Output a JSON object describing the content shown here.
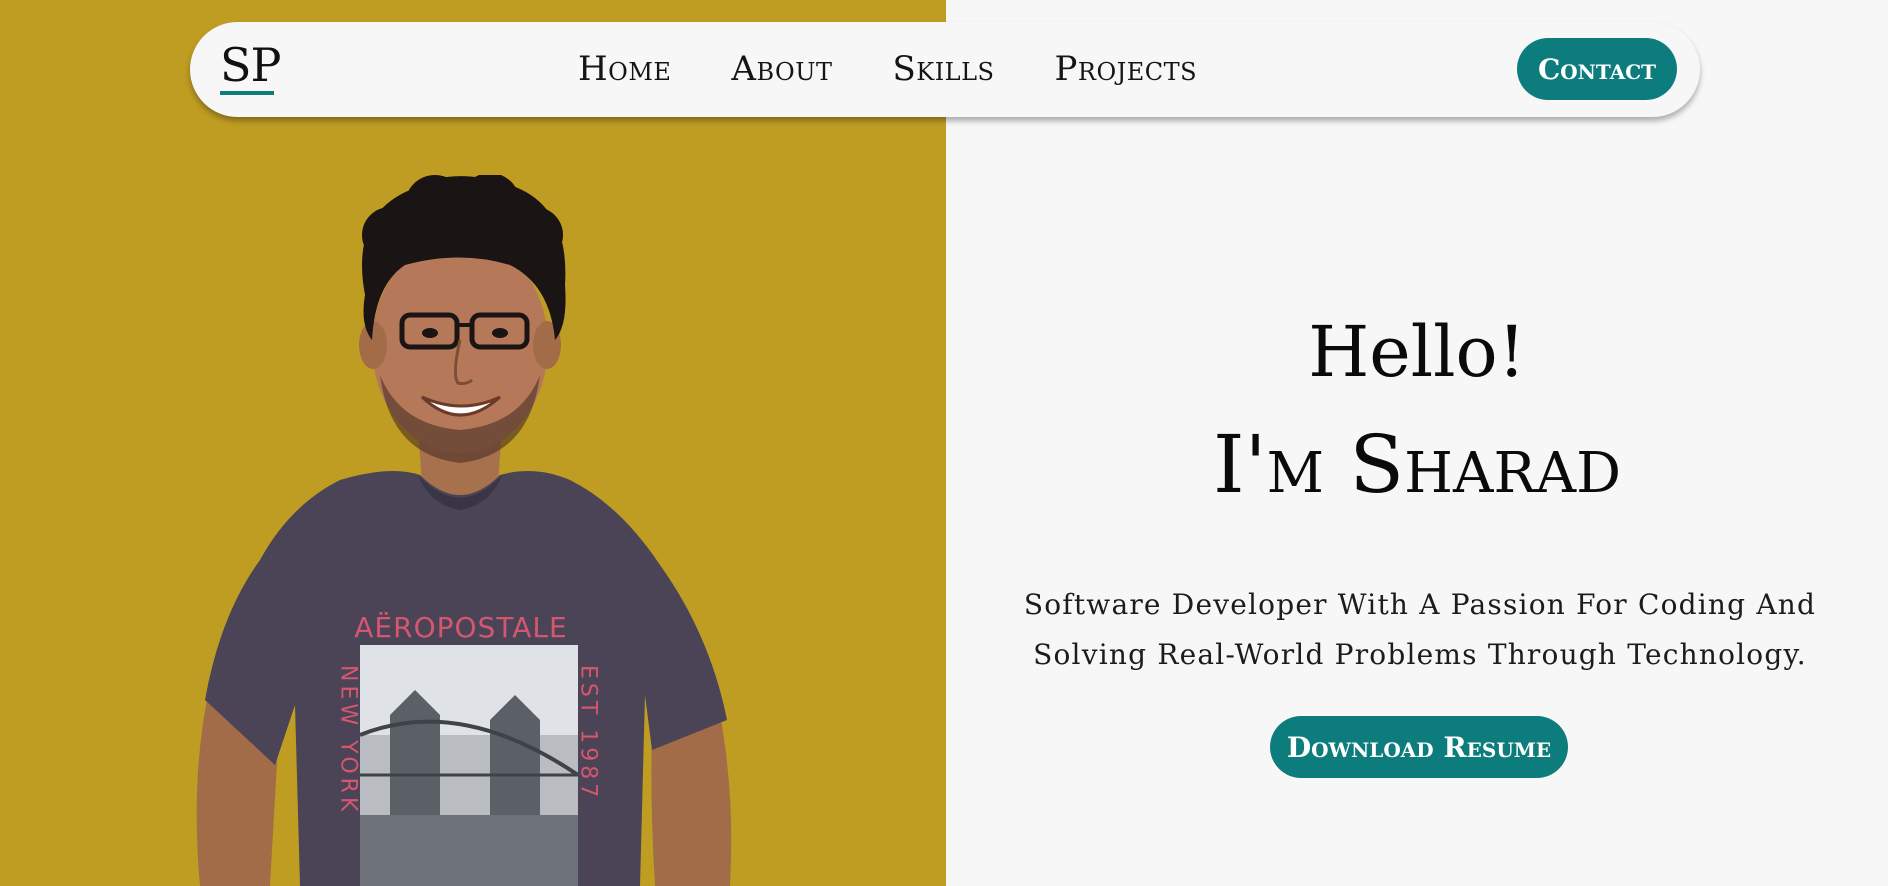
{
  "nav": {
    "logo": "SP",
    "links": [
      "Home",
      "About",
      "Skills",
      "Projects"
    ],
    "contact_label": "Contact"
  },
  "hero": {
    "greeting": "Hello!",
    "name": "I'm Sharad",
    "tagline_line1": "Software Developer With A Passion For Coding And",
    "tagline_line2": "Solving Real-World Problems Through Technology.",
    "download_label": "Download Resume",
    "shirt_brand": "AËROPOSTALE",
    "shirt_left": "NEW YORK",
    "shirt_right": "EST 1987"
  },
  "colors": {
    "accent": "#0d7c7c",
    "left_background": "#bf9d22",
    "right_background": "#f7f7f7",
    "text": "#0a0a0a"
  },
  "icons": {
    "portrait": "profile-photo"
  }
}
